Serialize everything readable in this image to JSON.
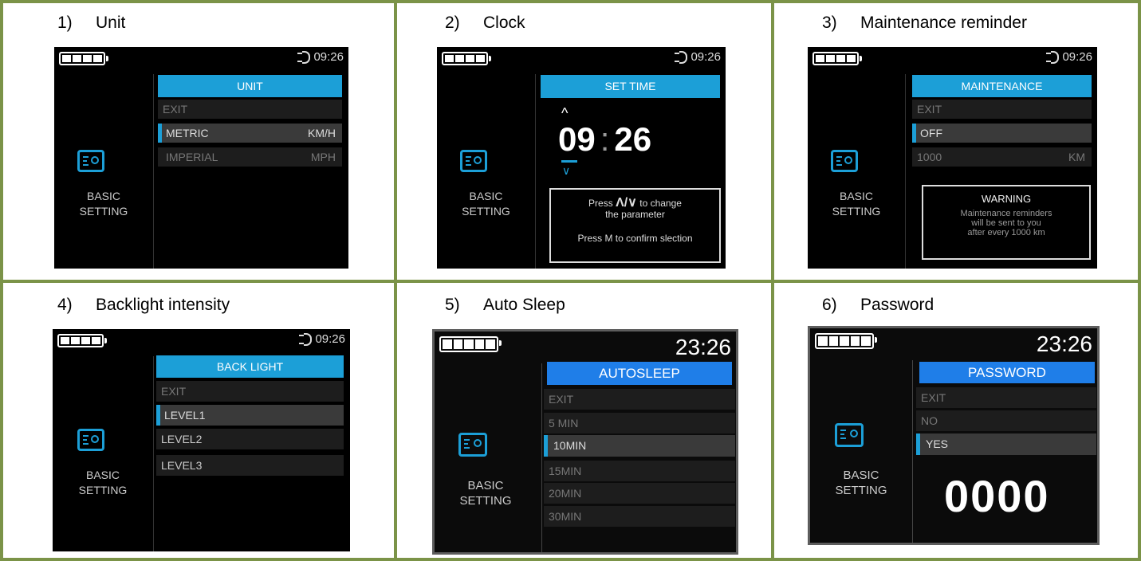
{
  "colors": {
    "border": "#7b9348",
    "accent": "#1c9fd7",
    "autosleep_header": "#1f7ee8"
  },
  "cells": [
    {
      "num": "1)",
      "title": "Unit"
    },
    {
      "num": "2)",
      "title": "Clock"
    },
    {
      "num": "3)",
      "title": "Maintenance reminder"
    },
    {
      "num": "4)",
      "title": "Backlight intensity"
    },
    {
      "num": "5)",
      "title": "Auto Sleep"
    },
    {
      "num": "6)",
      "title": "Password"
    }
  ],
  "side": {
    "line1": "BASIC",
    "line2": "SETTING",
    "icon": "settings-icon"
  },
  "unit": {
    "time": "09:26",
    "header": "UNIT",
    "exit": "EXIT",
    "metric": "METRIC",
    "metric_val": "KM/H",
    "imperial": "IMPERIAL",
    "imperial_val": "MPH"
  },
  "clock": {
    "time": "09:26",
    "header": "SET TIME",
    "hours": "09",
    "sep": ":",
    "minutes": "26",
    "press": "Press",
    "arrows": "Λ/∨",
    "to_change": "to change",
    "the_parameter": "the parameter",
    "confirm": "Press M to confirm slection"
  },
  "maint": {
    "time": "09:26",
    "header": "MAINTENANCE",
    "exit": "EXIT",
    "off": "OFF",
    "km_val": "1000",
    "km_unit": "KM",
    "warning": "WARNING",
    "msg1": "Maintenance reminders",
    "msg2": "will be sent to you",
    "msg3": "after every 1000 km"
  },
  "backlight": {
    "time": "09:26",
    "header": "BACK LIGHT",
    "exit": "EXIT",
    "l1": "LEVEL1",
    "l2": "LEVEL2",
    "l3": "LEVEL3"
  },
  "autosleep": {
    "time": "23:26",
    "header": "AUTOSLEEP",
    "items": [
      "EXIT",
      "5 MIN",
      "10MIN",
      "15MIN",
      "20MIN",
      "30MIN"
    ]
  },
  "password": {
    "time": "23:26",
    "header": "PASSWORD",
    "exit": "EXIT",
    "no": "NO",
    "yes": "YES",
    "code": "0000"
  }
}
